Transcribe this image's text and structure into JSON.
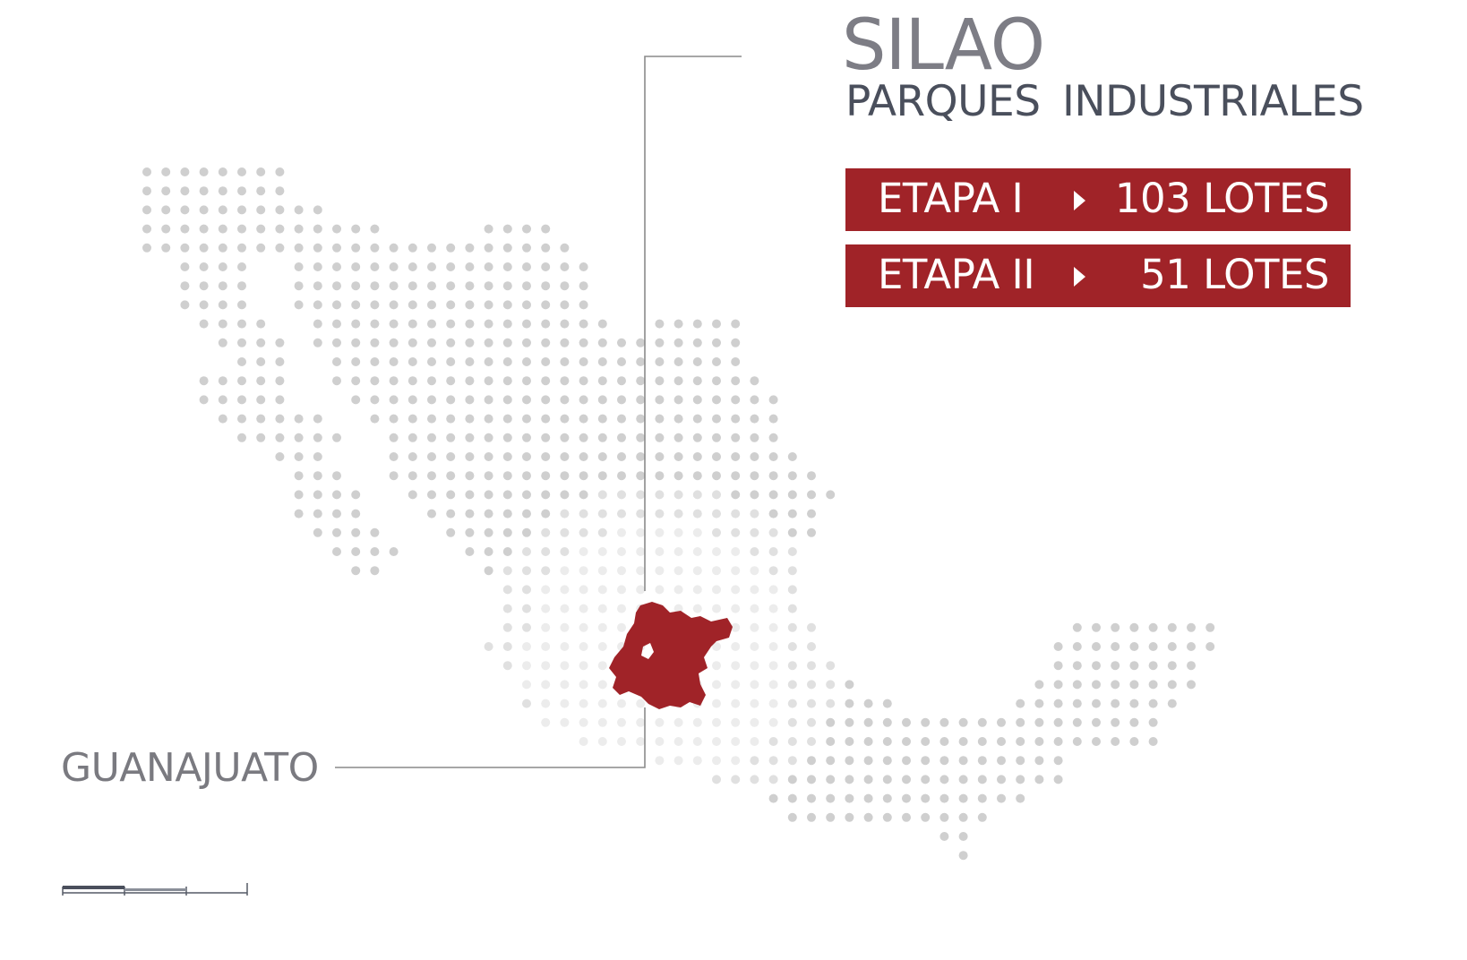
{
  "header": {
    "city": "SILAO",
    "subtitle": "PARQUES  INDUSTRIALES"
  },
  "stages": [
    {
      "name": "ETAPA I",
      "lots": "103 LOTES",
      "arrow_icon": "triangle-right-icon"
    },
    {
      "name": "ETAPA II",
      "lots": "51 LOTES",
      "arrow_icon": "triangle-right-icon"
    }
  ],
  "map": {
    "country": "Mexico",
    "highlighted_state": "GUANAJUATO"
  },
  "colors": {
    "accent": "#a02328",
    "dots": "#cfcfcf",
    "title_gray": "#7d7d85",
    "subtitle_dark": "#4a4f5c",
    "leader_line": "#8a8a8a"
  }
}
